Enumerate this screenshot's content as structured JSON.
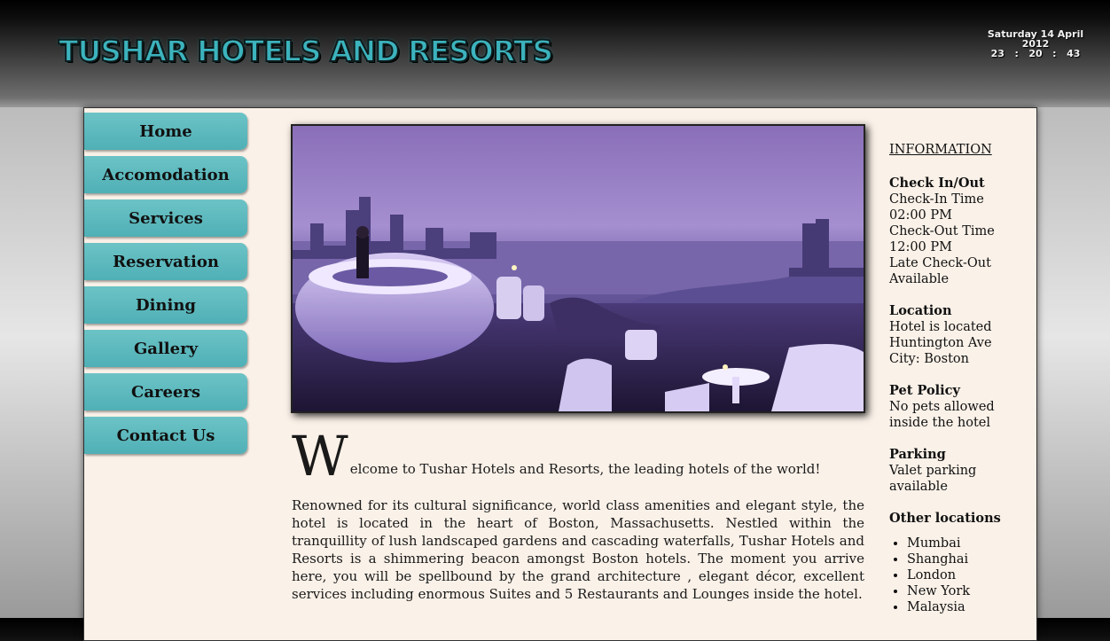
{
  "header": {
    "logo_text": "TUSHAR HOTELS AND RESORTS",
    "date": "Saturday 14 April 2012",
    "time": {
      "hours": "23",
      "minutes": "20",
      "seconds": "43",
      "separator": ":"
    }
  },
  "nav": {
    "items": [
      {
        "label": "Home"
      },
      {
        "label": "Accomodation"
      },
      {
        "label": "Services"
      },
      {
        "label": "Reservation"
      },
      {
        "label": "Dining"
      },
      {
        "label": "Gallery"
      },
      {
        "label": "Careers"
      },
      {
        "label": "Contact Us"
      }
    ]
  },
  "main": {
    "welcome_dropcap": "W",
    "welcome_rest": "elcome to Tushar Hotels and Resorts, the leading hotels of the world!",
    "paragraph": "Renowned for its cultural significance, world class amenities and elegant style, the hotel is located in the heart of Boston, Massachusetts. Nestled within the tranquillity of lush landscaped gardens and cascading waterfalls, Tushar Hotels and Resorts is a shimmering beacon amongst Boston hotels. The moment you arrive here, you will be spellbound by the grand architecture , elegant décor, excellent services including enormous Suites and 5 Restaurants and Lounges inside the hotel."
  },
  "info": {
    "heading": "INFORMATION",
    "checkin": {
      "title": "Check In/Out",
      "lines": [
        "Check-In Time",
        "02:00 PM",
        "Check-Out Time",
        "12:00 PM",
        "Late Check-Out",
        "Available"
      ]
    },
    "location": {
      "title": "Location",
      "lines": [
        "Hotel is located",
        "Huntington Ave",
        "City: Boston"
      ]
    },
    "pet": {
      "title": "Pet Policy",
      "text": "No pets allowed inside the hotel"
    },
    "parking": {
      "title": "Parking",
      "text": "Valet parking available"
    },
    "other": {
      "title": "Other locations",
      "items": [
        "Mumbai",
        "Shanghai",
        "London",
        "New York",
        "Malaysia"
      ]
    }
  },
  "colors": {
    "nav_button": "#5bb8bd",
    "page_bg": "#faf1e8",
    "logo": "#3cb3bd"
  }
}
